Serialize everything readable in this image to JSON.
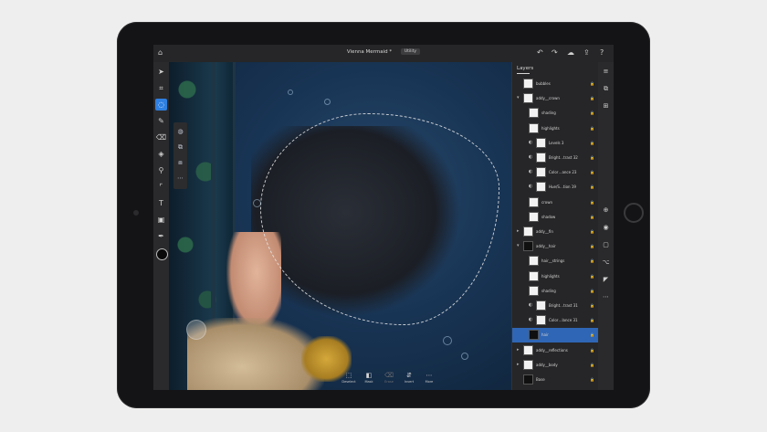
{
  "document": {
    "title": "Vienna Mermaid *",
    "badge": "Utility"
  },
  "topbar_icons": {
    "home": "⌂",
    "undo": "↶",
    "redo": "↷",
    "cloud": "☁",
    "share": "⇪",
    "help": "?"
  },
  "tools": [
    {
      "name": "move-tool",
      "glyph": "➤",
      "active": false
    },
    {
      "name": "transform-tool",
      "glyph": "⌗",
      "active": false
    },
    {
      "name": "lasso-tool",
      "glyph": "◌",
      "active": true
    },
    {
      "name": "brush-tool",
      "glyph": "✎",
      "active": false
    },
    {
      "name": "eraser-tool",
      "glyph": "⌫",
      "active": false
    },
    {
      "name": "fill-tool",
      "glyph": "◈",
      "active": false
    },
    {
      "name": "eyedropper-tool",
      "glyph": "⚲",
      "active": false
    },
    {
      "name": "crop-tool",
      "glyph": "⌜",
      "active": false
    },
    {
      "name": "type-tool",
      "glyph": "T",
      "active": false
    },
    {
      "name": "image-tool",
      "glyph": "▣",
      "active": false
    },
    {
      "name": "eyedropper-sample-tool",
      "glyph": "✒",
      "active": false
    }
  ],
  "subtools": [
    "◍",
    "⧉",
    "⧈",
    "⋯"
  ],
  "actions": [
    {
      "label": "Deselect",
      "glyph": "⬚",
      "dim": false
    },
    {
      "label": "Mask",
      "glyph": "◧",
      "dim": false
    },
    {
      "label": "Erase",
      "glyph": "⌫",
      "dim": true
    },
    {
      "label": "Invert",
      "glyph": "⇵",
      "dim": false
    },
    {
      "label": "More",
      "glyph": "⋯",
      "dim": false
    }
  ],
  "layers": {
    "title": "Layers",
    "items": [
      {
        "label": "bubbles",
        "indent": 0,
        "caret": "",
        "adj": "",
        "thumb": "light"
      },
      {
        "label": "addy__crown",
        "indent": 0,
        "caret": "▾",
        "adj": "",
        "thumb": "light"
      },
      {
        "label": "shading",
        "indent": 1,
        "caret": "",
        "adj": "",
        "thumb": "light"
      },
      {
        "label": "highlights",
        "indent": 1,
        "caret": "",
        "adj": "",
        "thumb": "light"
      },
      {
        "label": "Levels 3",
        "indent": 1,
        "caret": "",
        "adj": "◐",
        "thumb": "light"
      },
      {
        "label": "Bright…trast 32",
        "indent": 1,
        "caret": "",
        "adj": "◐",
        "thumb": "light"
      },
      {
        "label": "Color…ance 23",
        "indent": 1,
        "caret": "",
        "adj": "◐",
        "thumb": "light"
      },
      {
        "label": "Hue/S…tion 19",
        "indent": 1,
        "caret": "",
        "adj": "◐",
        "thumb": "light"
      },
      {
        "label": "crown",
        "indent": 1,
        "caret": "",
        "adj": "",
        "thumb": "light"
      },
      {
        "label": "shadow",
        "indent": 1,
        "caret": "",
        "adj": "",
        "thumb": "light"
      },
      {
        "label": "addy__fin",
        "indent": 0,
        "caret": "▸",
        "adj": "",
        "thumb": "light"
      },
      {
        "label": "addy__hair",
        "indent": 0,
        "caret": "▾",
        "adj": "",
        "thumb": "dark"
      },
      {
        "label": "hair__strings",
        "indent": 1,
        "caret": "",
        "adj": "",
        "thumb": "light"
      },
      {
        "label": "highlights",
        "indent": 1,
        "caret": "",
        "adj": "",
        "thumb": "light"
      },
      {
        "label": "shading",
        "indent": 1,
        "caret": "",
        "adj": "",
        "thumb": "light"
      },
      {
        "label": "Bright…trast 31",
        "indent": 1,
        "caret": "",
        "adj": "◐",
        "thumb": "light"
      },
      {
        "label": "Color…lance 31",
        "indent": 1,
        "caret": "",
        "adj": "◐",
        "thumb": "light"
      },
      {
        "label": "hair",
        "indent": 1,
        "caret": "",
        "adj": "",
        "thumb": "dark",
        "selected": true
      },
      {
        "label": "addy__reflections",
        "indent": 0,
        "caret": "▸",
        "adj": "",
        "thumb": "light"
      },
      {
        "label": "addy__body",
        "indent": 0,
        "caret": "▸",
        "adj": "",
        "thumb": "light"
      },
      {
        "label": "Base",
        "indent": 0,
        "caret": "",
        "adj": "",
        "thumb": "dark"
      }
    ]
  },
  "rightrail": [
    "≡",
    "⧉",
    "⊞",
    "⊕",
    "◉",
    "▢",
    "⌥",
    "◤",
    "⋯"
  ],
  "colors": {
    "accent": "#2f7fe0",
    "panel": "#262628",
    "selected_layer": "#2f66b5"
  }
}
